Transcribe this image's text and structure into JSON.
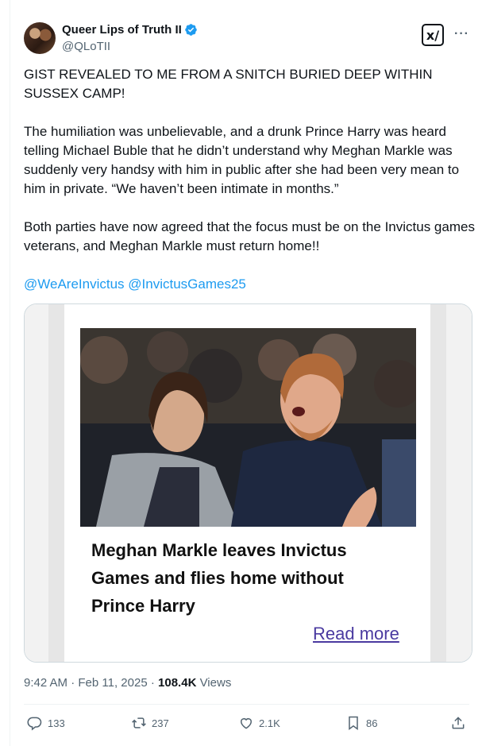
{
  "author": {
    "display_name": "Queer Lips of Truth II",
    "handle": "@QLoTII",
    "verified": true,
    "avatar_icon": "profile-photo"
  },
  "header": {
    "grok_label": "x/",
    "more_label": "···"
  },
  "tweet": {
    "paragraphs": [
      "GIST REVEALED TO ME FROM A SNITCH BURIED DEEP WITHIN SUSSEX CAMP!",
      "The humiliation was unbelievable, and a drunk Prince Harry was heard telling Michael Buble that he didn’t understand why Meghan Markle was suddenly very handsy with him in public after she had been very mean to him in private.  “We haven’t been intimate in months.”",
      "Both parties have now agreed that the focus must be on the Invictus games veterans, and Meghan Markle must return home!!"
    ],
    "mentions": [
      "@WeAreInvictus",
      "@InvictusGames25"
    ]
  },
  "card": {
    "headline": "Meghan Markle leaves Invictus Games and flies home without Prince Harry",
    "read_more": "Read more"
  },
  "meta": {
    "time": "9:42 AM",
    "separator": "·",
    "date": "Feb 11, 2025",
    "views_count": "108.4K",
    "views_label": "Views"
  },
  "actions": {
    "replies": "133",
    "reposts": "237",
    "likes": "2.1K",
    "bookmarks": "86"
  },
  "colors": {
    "link": "#1d9bf0",
    "secondary_text": "#536471",
    "border": "#cfd9de"
  }
}
